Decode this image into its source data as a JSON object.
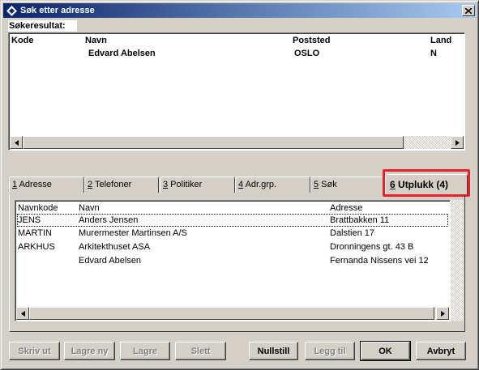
{
  "window": {
    "title": "Søk etter adresse"
  },
  "results": {
    "label": "Søkeresultat:",
    "columns": [
      "Kode",
      "Navn",
      "Poststed",
      "Land"
    ],
    "rows": [
      {
        "kode": "",
        "navn": "Edvard Abelsen",
        "poststed": "OSLO",
        "land": "N"
      }
    ]
  },
  "tabs": [
    {
      "num": "1",
      "label": " Adresse"
    },
    {
      "num": "2",
      "label": " Telefoner"
    },
    {
      "num": "3",
      "label": " Politiker"
    },
    {
      "num": "4",
      "label": " Adr.grp."
    },
    {
      "num": "5",
      "label": " Søk"
    },
    {
      "num": "6",
      "label": " Utplukk (4)",
      "active": true
    }
  ],
  "list": {
    "columns": [
      "Navnkode",
      "Navn",
      "Adresse"
    ],
    "rows": [
      {
        "navnkode": "JENS",
        "navn": "Anders Jensen",
        "adresse": "Brattbakken 11"
      },
      {
        "navnkode": "MARTIN",
        "navn": "Murermester Martinsen A/S",
        "adresse": "Dalstien 17"
      },
      {
        "navnkode": "ARKHUS",
        "navn": "Arkitekthuset ASA",
        "adresse": "Dronningens gt. 43 B"
      },
      {
        "navnkode": "",
        "navn": "Edvard Abelsen",
        "adresse": "Fernanda Nissens vei 12"
      }
    ]
  },
  "buttons": {
    "skriv_ut": "Skriv ut",
    "lagre_ny": "Lagre ny",
    "lagre": "Lagre",
    "slett": "Slett",
    "nullstill": "Nullstill",
    "legg_til": "Legg til",
    "ok": "OK",
    "avbryt": "Avbryt"
  },
  "colors": {
    "highlight": "#e8202a",
    "titlebar_start": "#0a246a",
    "titlebar_end": "#a6caf0"
  }
}
